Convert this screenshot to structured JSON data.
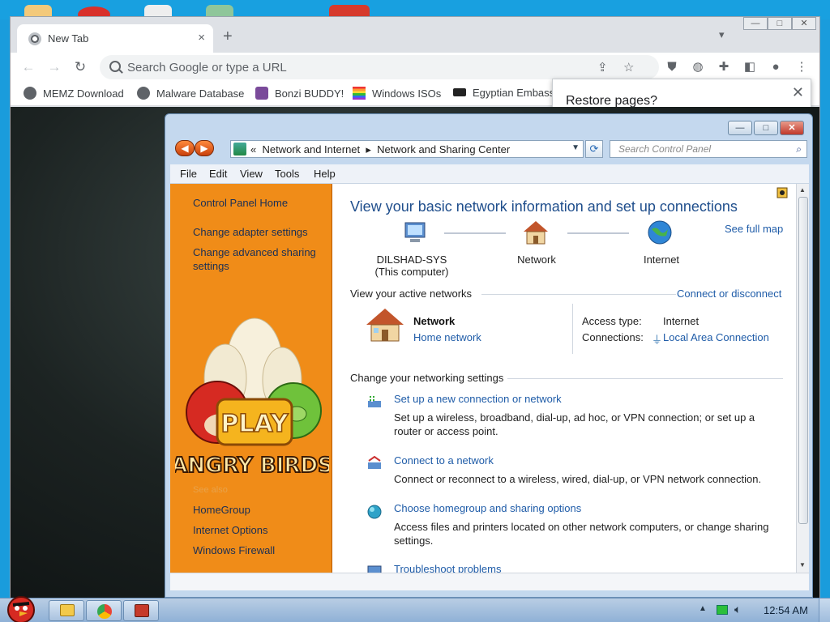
{
  "browser": {
    "tab_title": "New Tab",
    "tab_close": "×",
    "new_tab": "+",
    "omnibox_placeholder": "Search Google or type a URL",
    "win_min": "—",
    "win_max": "□",
    "win_close": "✕",
    "bookmarks": [
      {
        "label": "MEMZ Download",
        "icon": "globe-icon"
      },
      {
        "label": "Malware Database",
        "icon": "globe-icon"
      },
      {
        "label": "Bonzi BUDDY!",
        "icon": "bonzi-icon"
      },
      {
        "label": "Windows ISOs",
        "icon": "windows-flag-icon"
      },
      {
        "label": "Egyptian Embassy",
        "icon": "wix-icon"
      }
    ],
    "restore_title": "Restore pages?",
    "restore_close": "✕"
  },
  "control_panel": {
    "breadcrumb_root": "«",
    "breadcrumb_1": "Network and Internet",
    "breadcrumb_sep": "▸",
    "breadcrumb_2": "Network and Sharing Center",
    "search_placeholder": "Search Control Panel",
    "menu": [
      "File",
      "Edit",
      "View",
      "Tools",
      "Help"
    ],
    "sidebar": {
      "home": "Control Panel Home",
      "adapter": "Change adapter settings",
      "advanced": "Change advanced sharing settings",
      "see_also": "See also",
      "bottom_links": [
        "HomeGroup",
        "Internet Options",
        "Windows Firewall"
      ]
    },
    "ad": {
      "play": "PLAY",
      "brand": "ANGRY BIRDS"
    },
    "main": {
      "heading": "View your basic network information and set up connections",
      "see_full_map": "See full map",
      "nodes": [
        {
          "line1": "DILSHAD-SYS",
          "line2": "(This computer)"
        },
        {
          "line1": "Network",
          "line2": ""
        },
        {
          "line1": "Internet",
          "line2": ""
        }
      ],
      "active_networks": "View your active networks",
      "connect_disconnect": "Connect or disconnect",
      "network_name": "Network",
      "network_type": "Home network",
      "access_type_label": "Access type:",
      "access_type_value": "Internet",
      "connections_label": "Connections:",
      "connections_value": "Local Area Connection",
      "change_settings": "Change your networking settings",
      "tasks": [
        {
          "title": "Set up a new connection or network",
          "desc": "Set up a wireless, broadband, dial-up, ad hoc, or VPN connection; or set up a router or access point."
        },
        {
          "title": "Connect to a network",
          "desc": "Connect or reconnect to a wireless, wired, dial-up, or VPN network connection."
        },
        {
          "title": "Choose homegroup and sharing options",
          "desc": "Access files and printers located on other network computers, or change sharing settings."
        },
        {
          "title": "Troubleshoot problems",
          "desc": ""
        }
      ]
    }
  },
  "taskbar": {
    "clock": "12:54 AM"
  }
}
